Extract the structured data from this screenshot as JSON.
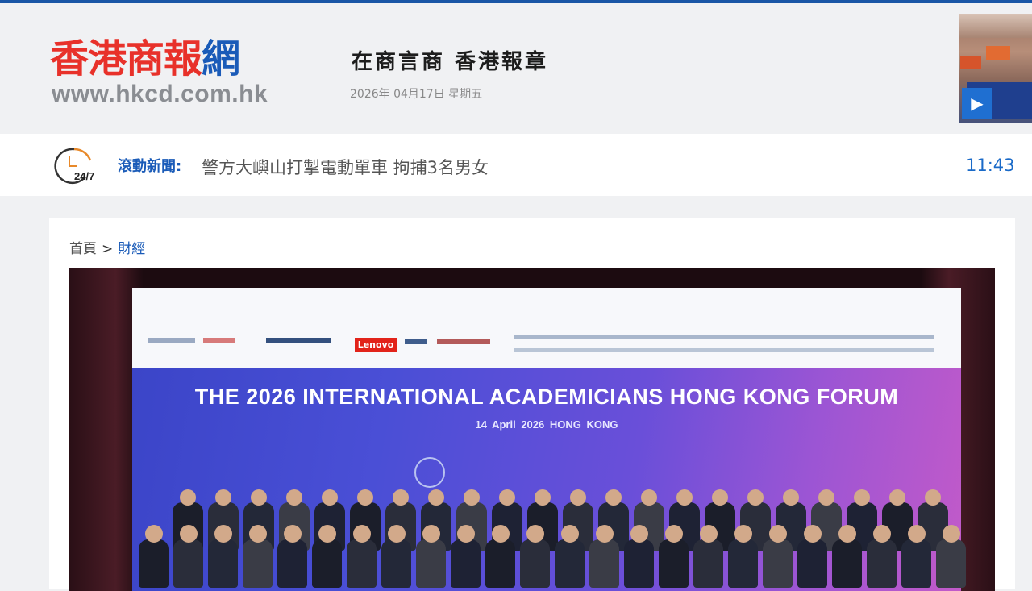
{
  "header": {
    "logo_text": "香港商報",
    "logo_suffix": "網",
    "site_url": "www.hkcd.com.hk",
    "slogan": "在商言商 香港報章",
    "date": "2026年 04月17日 星期五",
    "video_icon": "play-icon"
  },
  "ticker": {
    "icon": "clock-24-7-icon",
    "icon_text": "24/7",
    "label": "滾動新聞:",
    "headline": "警方大嶼山打掣電動單車 拘捕3名男女",
    "time": "11:43"
  },
  "breadcrumb": {
    "home": "首頁",
    "separator": ">",
    "current": "財經"
  },
  "photo": {
    "banner_title": "THE 2026 INTERNATIONAL ACADEMICIANS HONG KONG FORUM",
    "banner_subtitle": "14 April 2026   HONG KONG",
    "sponsor_logo": "Lenovo"
  },
  "colors": {
    "brand_red": "#e8312a",
    "brand_blue": "#1a5bb8",
    "link_blue": "#1a6ac8",
    "top_bar": "#1a56a6"
  }
}
